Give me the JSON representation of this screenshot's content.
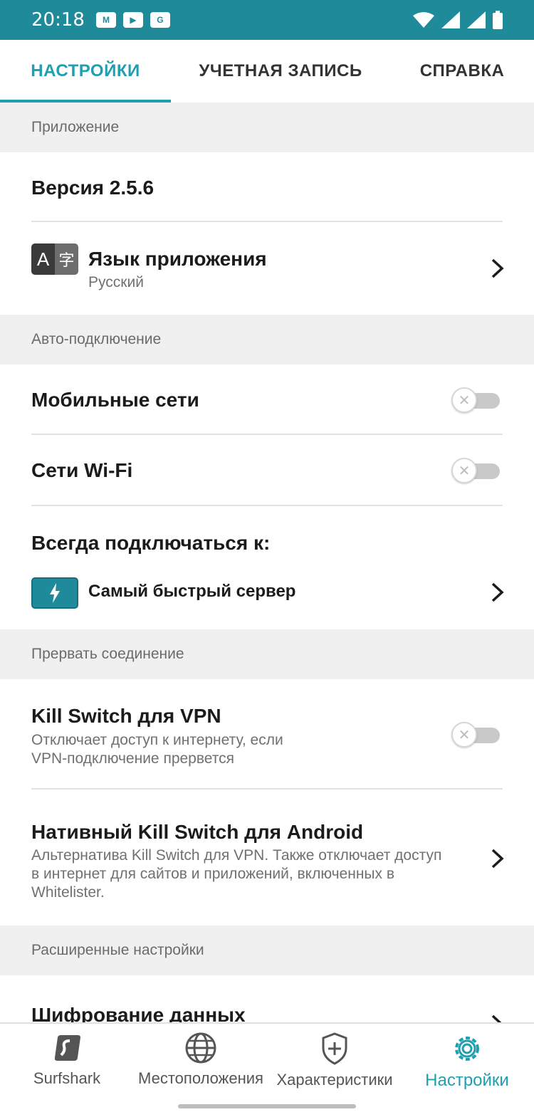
{
  "status_bar": {
    "time": "20:18"
  },
  "tabs": [
    {
      "label": "НАСТРОЙКИ",
      "active": true
    },
    {
      "label": "УЧЕТНАЯ ЗАПИСЬ",
      "active": false
    },
    {
      "label": "СПРАВКА",
      "active": false
    }
  ],
  "sections": {
    "app": {
      "header": "Приложение",
      "version": "Версия 2.5.6",
      "language_title": "Язык приложения",
      "language_value": "Русский"
    },
    "auto_connect": {
      "header": "Авто-подключение",
      "mobile": "Мобильные сети",
      "wifi": "Сети Wi-Fi",
      "always_connect": "Всегда подключаться к:",
      "server": "Самый быстрый сервер"
    },
    "kill": {
      "header": "Прервать соединение",
      "vpn_title": "Kill Switch для VPN",
      "vpn_desc_1": "Отключает доступ к интернету, если",
      "vpn_desc_2": "VPN-подключение прервется",
      "native_title": "Нативный Kill Switch для Android",
      "native_desc_1": "Альтернатива Kill Switch для VPN. Также отключает доступ",
      "native_desc_2": "в интернет для сайтов и приложений, включенных в",
      "native_desc_3": "Whitelister."
    },
    "advanced": {
      "header": "Расширенные настройки",
      "encryption": "Шифрование данных"
    }
  },
  "bottom_nav": [
    {
      "label": "Surfshark",
      "icon": "surfshark-logo-icon",
      "active": false
    },
    {
      "label": "Местоположения",
      "icon": "globe-icon",
      "active": false
    },
    {
      "label": "Характеристики",
      "icon": "shield-plus-icon",
      "active": false
    },
    {
      "label": "Настройки",
      "icon": "gear-icon",
      "active": true
    }
  ],
  "colors": {
    "accent": "#1f9fb0",
    "status_bar": "#1f8a9a"
  }
}
